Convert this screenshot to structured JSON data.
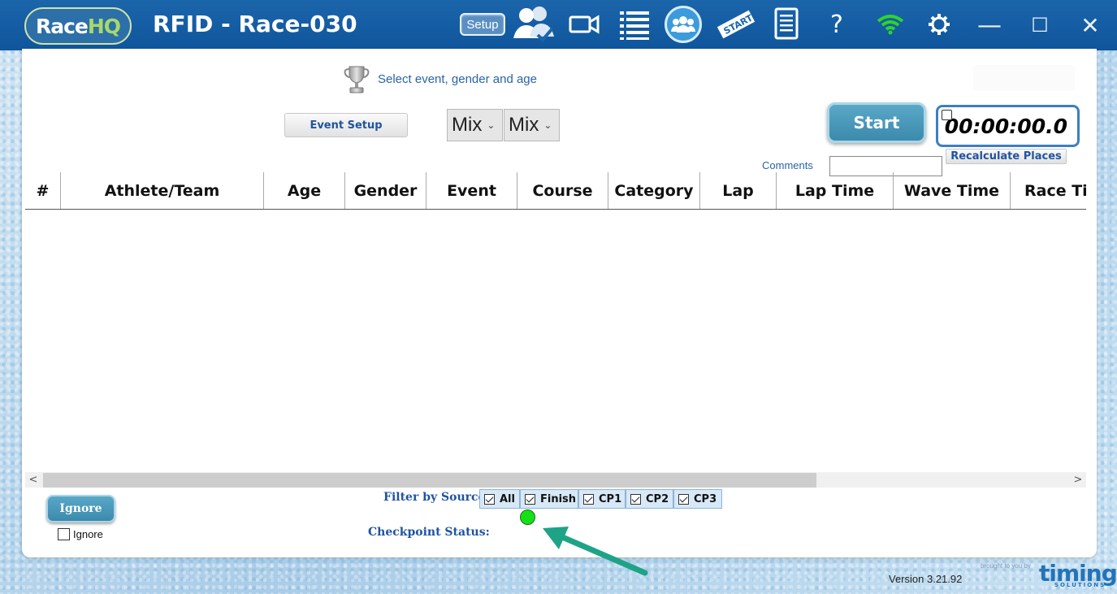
{
  "app": {
    "logo_text_a": "Race",
    "logo_text_b": "HQ",
    "title": "RFID - Race-030",
    "colors": {
      "titlebar": "#1565a8",
      "accent": "#3b8aac",
      "link": "#2864a8",
      "status_ok": "#16e016"
    }
  },
  "toolbar": {
    "setup_label": "Setup",
    "icons": [
      "athletes-icon",
      "video-camera-icon",
      "list-icon",
      "teams-icon",
      "start-flag-icon",
      "document-icon",
      "help-icon",
      "wifi-icon",
      "settings-icon"
    ],
    "help_glyph": "?"
  },
  "window_controls": {
    "minimize": "—",
    "maximize": "☐",
    "close": "✕"
  },
  "event": {
    "hint": "Select event, gender and age",
    "setup_button": "Event Setup",
    "gender_value": "Mix",
    "age_value": "Mix"
  },
  "timer": {
    "start_label": "Start",
    "clock": "00:00:00.0",
    "recalc_label": "Recalculate Places",
    "comments_label": "Comments",
    "comments_value": ""
  },
  "table": {
    "columns": [
      "#",
      "Athlete/Team",
      "Age",
      "Gender",
      "Event",
      "Course",
      "Category",
      "Lap",
      "Lap Time",
      "Wave Time",
      "Race Ti"
    ],
    "rows": []
  },
  "scroll": {
    "left": "<",
    "right": ">"
  },
  "ignore": {
    "button_label": "Ignore",
    "checkbox_label": "Ignore"
  },
  "filter": {
    "label": "Filter by Source:",
    "sources": [
      "All",
      "Finish",
      "CP1",
      "CP2",
      "CP3"
    ],
    "checkpoint_label": "Checkpoint Status:"
  },
  "footer": {
    "version": "Version 3.21.92",
    "brought_by": "brought to you by",
    "brand": "timing",
    "brand_sub": "SOLUTIONS"
  }
}
